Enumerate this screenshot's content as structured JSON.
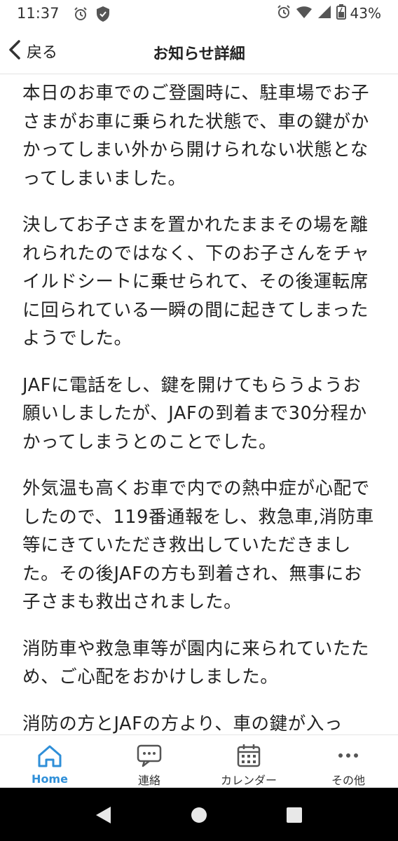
{
  "status_bar": {
    "time": "11:37",
    "battery": "43%",
    "icons": [
      "alarm-icon",
      "shield-icon",
      "alarm-icon",
      "wifi-icon",
      "signal-icon",
      "battery-icon"
    ]
  },
  "header": {
    "back_label": "戻る",
    "title": "お知らせ詳細"
  },
  "content": {
    "paragraphs": [
      "本日のお車でのご登園時に、駐車場でお子さまがお車に乗られた状態で、車の鍵がかかってしまい外から開けられない状態となってしまいました。",
      "決してお子さまを置かれたままその場を離れられたのではなく、下のお子さんをチャイルドシートに乗せられて、その後運転席に回られている一瞬の間に起きてしまったようでした。",
      "JAFに電話をし、鍵を開けてもらうようお願いしましたが、JAFの到着まで30分程かかってしまうとのことでした。",
      "外気温も高くお車で内での熱中症が心配でしたので、119番通報をし、救急車,消防車等にきていただき救出していただきました。その後JAFの方も到着され、無事にお子さまも救出されました。",
      "消防車や救急車等が園内に来られていたため、ご心配をおかけしました。",
      "消防の方とJAFの方より、車の鍵が入っ"
    ]
  },
  "bottom_nav": {
    "items": [
      {
        "label": "Home",
        "icon": "home-icon",
        "active": true
      },
      {
        "label": "連絡",
        "icon": "chat-icon",
        "active": false
      },
      {
        "label": "カレンダー",
        "icon": "calendar-icon",
        "active": false
      },
      {
        "label": "その他",
        "icon": "more-icon",
        "active": false
      }
    ]
  },
  "colors": {
    "accent": "#2f8fd8",
    "text": "#222222",
    "system_nav": "#000000"
  }
}
